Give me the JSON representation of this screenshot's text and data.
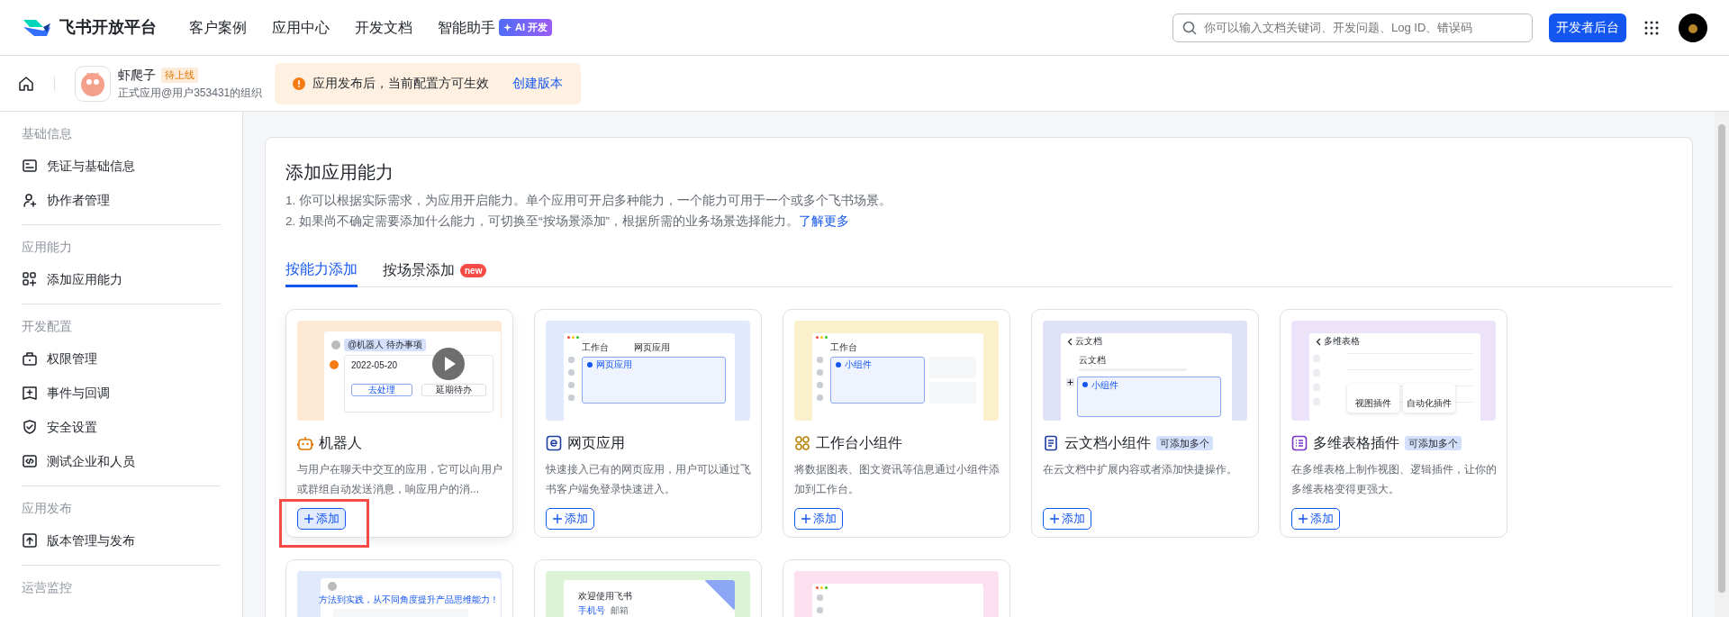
{
  "topbar": {
    "brand": "飞书开放平台",
    "nav": [
      {
        "label": "客户案例"
      },
      {
        "label": "应用中心"
      },
      {
        "label": "开发文档"
      },
      {
        "label": "智能助手",
        "badge": "AI 开发"
      }
    ],
    "search": {
      "placeholder": "你可以输入文档关键词、开发问题、Log ID、错误码"
    },
    "console_button": "开发者后台"
  },
  "app_header": {
    "name": "虾爬子",
    "status": "待上线",
    "org": "正式应用@用户353431的组织",
    "notice": {
      "text": "应用发布后，当前配置方可生效",
      "link": "创建版本"
    }
  },
  "sidebar": {
    "groups": [
      {
        "heading": "基础信息",
        "items": [
          {
            "label": "凭证与基础信息"
          },
          {
            "label": "协作者管理"
          }
        ]
      },
      {
        "heading": "应用能力",
        "items": [
          {
            "label": "添加应用能力"
          }
        ]
      },
      {
        "heading": "开发配置",
        "items": [
          {
            "label": "权限管理"
          },
          {
            "label": "事件与回调"
          },
          {
            "label": "安全设置"
          },
          {
            "label": "测试企业和人员"
          }
        ]
      },
      {
        "heading": "应用发布",
        "items": [
          {
            "label": "版本管理与发布"
          }
        ]
      },
      {
        "heading": "运营监控"
      }
    ]
  },
  "panel": {
    "title": "添加应用能力",
    "lines": [
      "1. 你可以根据实际需求，为应用开启能力。单个应用可开启多种能力，一个能力可用于一个或多个飞书场景。",
      "2. 如果尚不确定需要添加什么能力，可切换至“按场景添加”，根据所需的业务场景选择能力。"
    ],
    "learn_more": "了解更多",
    "tabs": [
      {
        "label": "按能力添加",
        "selected": true
      },
      {
        "label": "按场景添加",
        "selected": false,
        "badge": "new"
      }
    ],
    "cards": [
      {
        "title": "机器人",
        "color": "#fde9d4",
        "highlighted": true,
        "description": "与用户在聊天中交互的应用，它可以向用户或群组自动发送消息，响应用户的消...",
        "add": "添加",
        "mock": {
          "kind": "chat",
          "mention": "@机器人 待办事项",
          "date": "2022-05-20",
          "primary": "去处理",
          "secondary": "延期待办"
        }
      },
      {
        "title": "网页应用",
        "color": "#e1e9fd",
        "highlighted": false,
        "description": "快速接入已有的网页应用，用户可以通过飞书客户端免登录快速进入。",
        "add": "添加",
        "mock": {
          "kind": "app",
          "tabs": [
            "工作台",
            "网页应用"
          ],
          "box": "网页应用"
        }
      },
      {
        "title": "工作台小组件",
        "color": "#fbf0cc",
        "highlighted": false,
        "description": "将数据图表、图文资讯等信息通过小组件添加到工作台。",
        "add": "添加",
        "mock": {
          "kind": "widget",
          "tabs": [
            "工作台"
          ],
          "box": "小组件"
        }
      },
      {
        "title": "云文档小组件",
        "color": "#e0e2f8",
        "highlighted": false,
        "tag": "可添加多个",
        "description": "在云文档中扩展内容或者添加快捷操作。",
        "add": "添加",
        "mock": {
          "kind": "doc",
          "title": "云文档",
          "heading": "云文档",
          "box": "小组件"
        }
      },
      {
        "title": "多维表格插件",
        "color": "#ece3fb",
        "highlighted": false,
        "tag": "可添加多个",
        "description": "在多维表格上制作视图、逻辑插件，让你的多维表格变得更强大。",
        "add": "添加",
        "mock": {
          "kind": "table",
          "title": "多维表格",
          "plugins": [
            "视图插件",
            "自动化插件"
          ]
        }
      },
      {
        "color": "#e1e9fd",
        "mock": {
          "kind": "article",
          "banner": "方法到实践，从不同角度提升产品思维能力！"
        }
      },
      {
        "color": "#dcf3d6",
        "mock": {
          "kind": "login",
          "title": "欢迎使用飞书",
          "tabs": [
            "手机号",
            "邮箱"
          ]
        }
      },
      {
        "color": "#fde0ef",
        "mock": {
          "kind": "blank"
        }
      }
    ]
  }
}
